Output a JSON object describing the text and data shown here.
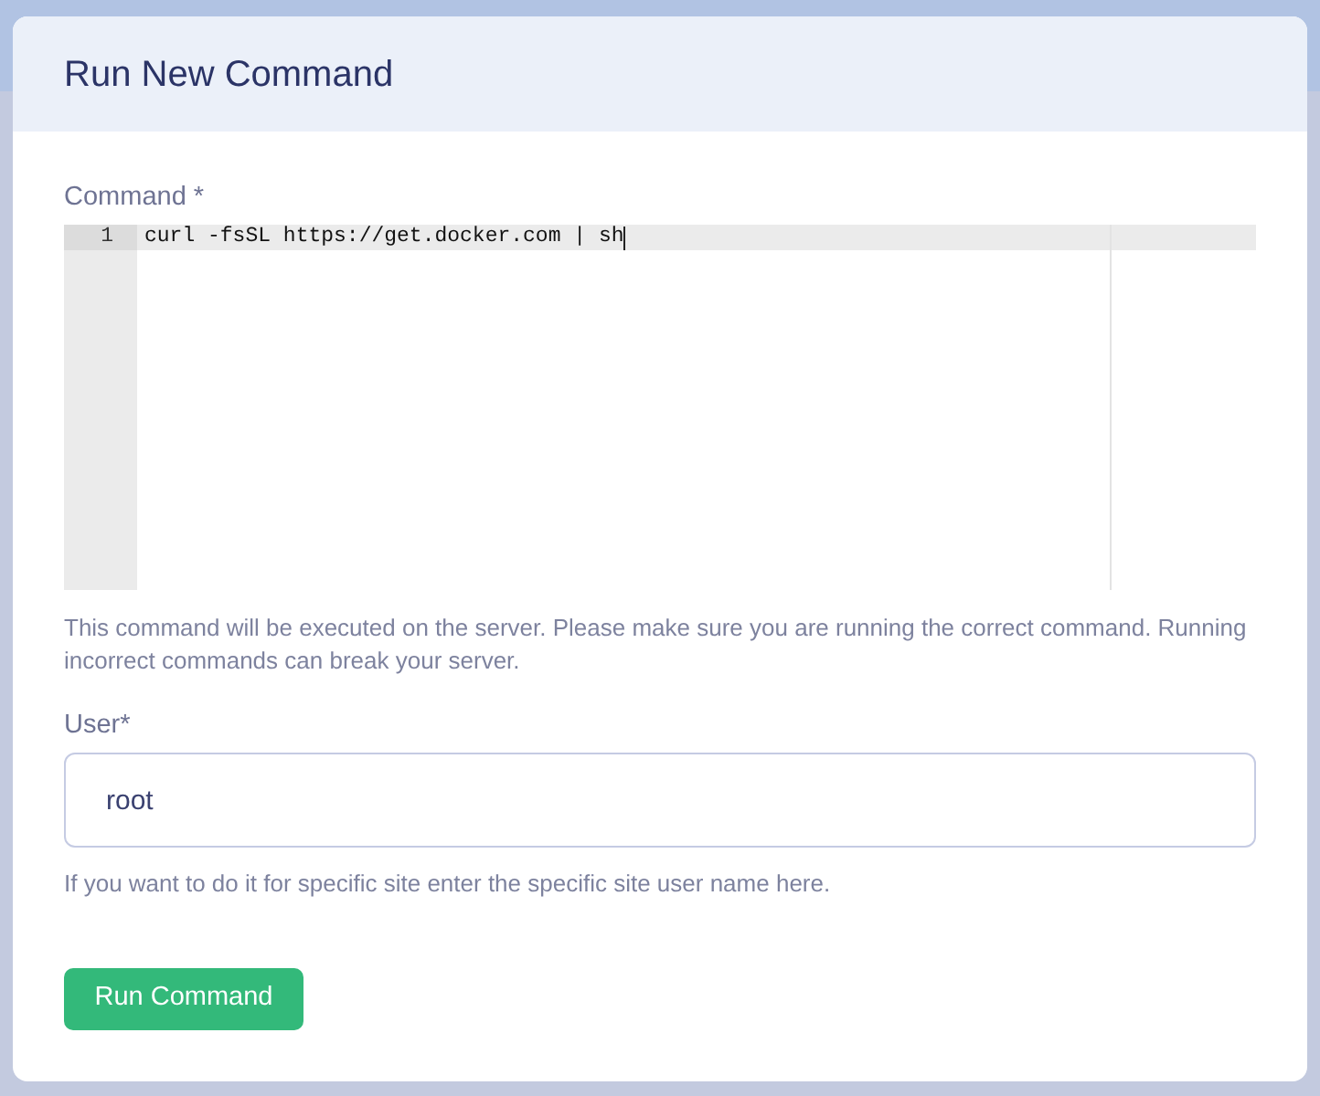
{
  "dialog": {
    "title": "Run New Command"
  },
  "command": {
    "label": "Command *",
    "editor": {
      "lines": [
        {
          "number": "1",
          "text": "curl -fsSL https://get.docker.com | sh",
          "active": true
        }
      ]
    },
    "help": "This command will be executed on the server. Please make sure you are running the correct command. Running incorrect commands can break your server."
  },
  "user": {
    "label": "User*",
    "value": "root",
    "help": "If you want to do it for specific site enter the specific site user name here."
  },
  "buttons": [
    {
      "label": "Run Command",
      "kind": "primary"
    }
  ]
}
